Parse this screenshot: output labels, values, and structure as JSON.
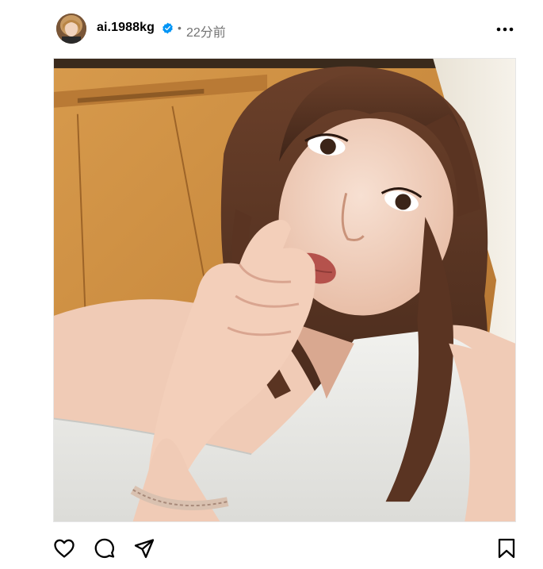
{
  "post": {
    "author": {
      "username": "ai.1988kg",
      "verified_icon": "verified-badge-icon",
      "avatar": "profile-avatar"
    },
    "separator": "•",
    "posted_time": "22分前",
    "image": {
      "subject": "photo",
      "colors": {
        "wood": "#c98a3e",
        "hair": "#5a3422",
        "skin": "#f2d2bf",
        "top": "#e9e9e6"
      }
    }
  },
  "icons": {
    "more": "more-options-icon",
    "like": "heart-icon",
    "comment": "comment-icon",
    "share": "paper-plane-icon",
    "save": "bookmark-icon"
  },
  "colors": {
    "verified": "#0095f6",
    "secondary_text": "#737373"
  }
}
